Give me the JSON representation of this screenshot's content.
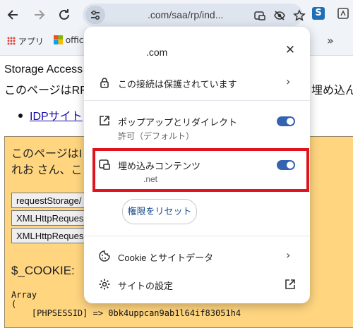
{
  "browser": {
    "url": ".com/saa/rp/ind...",
    "bookmarks": [
      {
        "label": "アプリ"
      },
      {
        "label": "offic"
      }
    ],
    "overflow_label": "»"
  },
  "page": {
    "line1": "Storage Access",
    "line2_left": "このページはRF",
    "line2_right": "埋め込ん",
    "link": "IDPサイト",
    "frame": {
      "line1": "このページはI",
      "line2": "れお さん、こ",
      "buttons": [
        "requestStorage/",
        "XMLHttpReques",
        "XMLHttpReques"
      ],
      "cookie_heading": "$_COOKIE:",
      "pre_lines": [
        "Array",
        "(",
        "    [PHPSESSID] => 0bk4uppcan9ab1l64if83051h4"
      ]
    }
  },
  "popup": {
    "title": ".com",
    "connection_label": "この接続は保護されています",
    "popup_redirect_label": "ポップアップとリダイレクト",
    "popup_redirect_sub": "許可（デフォルト）",
    "embedded_label": "埋め込みコンテンツ",
    "embedded_sub": ".net",
    "reset_label": "権限をリセット",
    "cookie_label": "Cookie とサイトデータ",
    "site_settings_label": "サイトの設定",
    "toggles": {
      "popup_redirect": true,
      "embedded": true
    }
  },
  "colors": {
    "toggle_on": "#3463b0",
    "highlight": "#e0141c",
    "frame_bg": "#ffd580"
  }
}
